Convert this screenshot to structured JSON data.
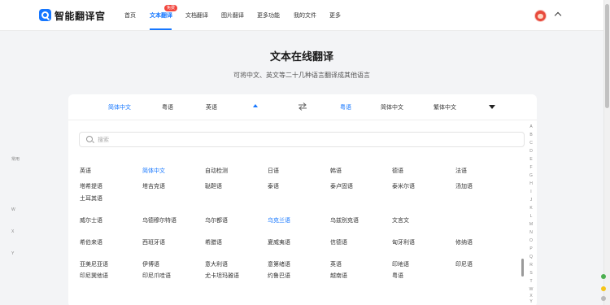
{
  "header": {
    "brand": "智能翻译官",
    "nav": [
      {
        "label": "首页",
        "active": false
      },
      {
        "label": "文本翻译",
        "active": true,
        "badge": "免费"
      },
      {
        "label": "文档翻译",
        "active": false
      },
      {
        "label": "图片翻译",
        "active": false
      },
      {
        "label": "更多功能",
        "active": false
      },
      {
        "label": "我的文件",
        "active": false
      },
      {
        "label": "更多",
        "active": false
      }
    ]
  },
  "hero": {
    "title": "文本在线翻译",
    "subtitle": "可将中文、英文等二十几种语言翻译成其他语言"
  },
  "lang_bar": {
    "source": [
      "简体中文",
      "粤语",
      "英语"
    ],
    "target": [
      "粤语",
      "简体中文",
      "繁体中文"
    ],
    "swap_icon": "swap-arrows-icon"
  },
  "search": {
    "placeholder": "搜索"
  },
  "sections": {
    "common": "常用",
    "w": "W",
    "x": "X",
    "y": "Y"
  },
  "languages": {
    "common_row1": [
      "英语",
      "简体中文",
      "自动检测",
      "日语",
      "韩语",
      "德语",
      "法语"
    ],
    "common_row2": [
      "塔希提语",
      "塔吉克语",
      "鞑靼语",
      "泰语",
      "泰卢固语",
      "泰米尔语",
      "汤加语"
    ],
    "common_row3": [
      "土耳其语"
    ],
    "w_row": [
      "威尔士语",
      "乌德穆尔特语",
      "乌尔都语",
      "乌克兰语",
      "乌兹别克语",
      "文言文"
    ],
    "x_row": [
      "希伯来语",
      "西班牙语",
      "希腊语",
      "夏威夷语",
      "信德语",
      "匈牙利语",
      "修纳语"
    ],
    "y_row1": [
      "亚美尼亚语",
      "伊博语",
      "意大利语",
      "意第绪语",
      "英语",
      "印地语",
      "印尼语"
    ],
    "y_row2": [
      "印尼巽他语",
      "印尼爪哇语",
      "尤卡坦玛雅语",
      "约鲁巴语",
      "越南语",
      "粤语"
    ]
  },
  "alphabet": [
    "A",
    "B",
    "C",
    "D",
    "E",
    "F",
    "G",
    "H",
    "I",
    "J",
    "K",
    "L",
    "M",
    "N",
    "O",
    "P",
    "Q",
    "R",
    "S",
    "T",
    "W",
    "X",
    "Y"
  ],
  "colors": {
    "accent": "#1677ff",
    "badge": "#f2453d"
  }
}
